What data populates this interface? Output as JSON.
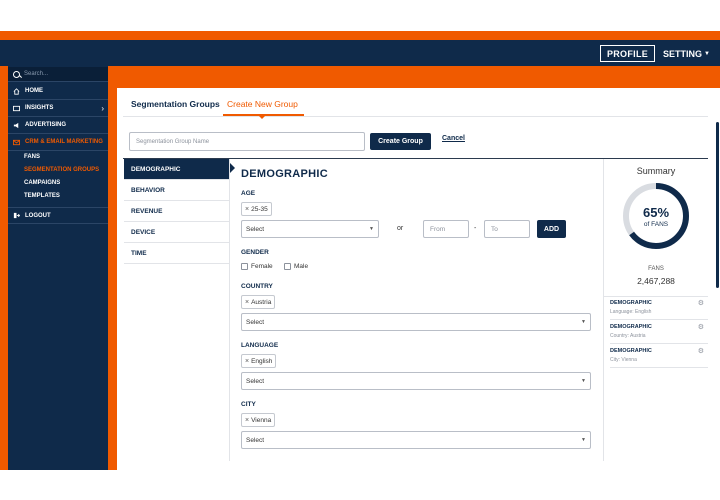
{
  "header": {
    "profile_label": "PROFILE",
    "setting_label": "SETTING",
    "setting_caret": "▼"
  },
  "sidebar": {
    "search_placeholder": "Search...",
    "items": [
      {
        "label": "HOME",
        "icon": "home-icon"
      },
      {
        "label": "INSIGHTS",
        "icon": "insights-icon",
        "chevron": "›"
      },
      {
        "label": "ADVERTISING",
        "icon": "megaphone-icon"
      },
      {
        "label": "CRM & EMAIL MARKETING",
        "icon": "mail-icon"
      }
    ],
    "sub_items": [
      "FANS",
      "SEGMENTATION GROUPS",
      "CAMPAIGNS",
      "TEMPLATES"
    ],
    "logout_label": "LOGOUT",
    "active_color": "#f05a00"
  },
  "tabs": {
    "segmentation_groups": "Segmentation Groups",
    "create_new_group": "Create New Group"
  },
  "form": {
    "group_name_placeholder": "Segmentation Group Name",
    "create_group_label": "Create Group",
    "cancel_label": "Cancel"
  },
  "categories": [
    "DEMOGRAPHIC",
    "BEHAVIOR",
    "REVENUE",
    "DEVICE",
    "TIME"
  ],
  "demographic": {
    "title": "DEMOGRAPHIC",
    "age": {
      "label": "AGE",
      "chip": "25-35",
      "select": "Select",
      "or": "or",
      "from_placeholder": "From",
      "dash": "-",
      "to_placeholder": "To",
      "add_label": "ADD"
    },
    "gender": {
      "label": "GENDER",
      "options": [
        "Female",
        "Male"
      ]
    },
    "country": {
      "label": "COUNTRY",
      "chip": "Austria",
      "select": "Select"
    },
    "language": {
      "label": "LANGUAGE",
      "chip": "English",
      "select": "Select"
    },
    "city": {
      "label": "CITY",
      "chip": "Vienna",
      "select": "Select"
    }
  },
  "summary": {
    "title": "Summary",
    "percent_text": "65%",
    "percent_value": 0.65,
    "of_fans": "of FANS",
    "fans_label": "FANS",
    "fans_value": "2,467,288",
    "items": [
      {
        "category": "DEMOGRAPHIC",
        "value": "Language: English"
      },
      {
        "category": "DEMOGRAPHIC",
        "value": "Country: Austria"
      },
      {
        "category": "DEMOGRAPHIC",
        "value": "City: Vienna"
      }
    ]
  },
  "colors": {
    "navy": "#0f2a4a",
    "orange": "#f05a00"
  }
}
